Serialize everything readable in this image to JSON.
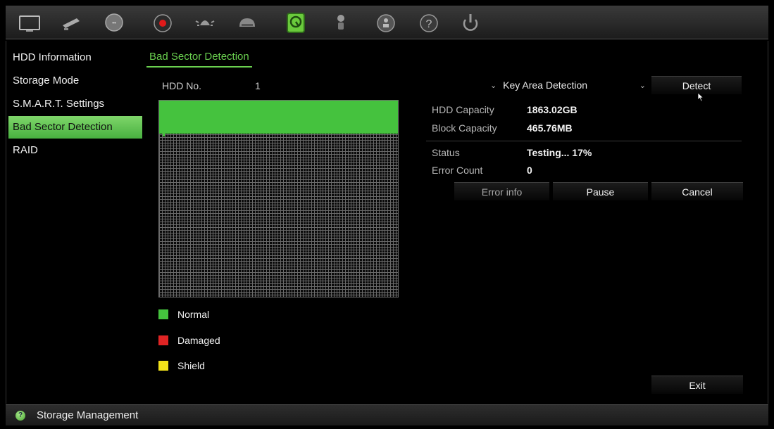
{
  "toolbar": {
    "icons": [
      "display-icon",
      "camera-icon",
      "network-icon",
      "record-icon",
      "alarm-icon",
      "device-icon",
      "hdd-icon",
      "user-icon",
      "system-info-icon",
      "help-icon",
      "power-icon"
    ],
    "active": "hdd-icon"
  },
  "sidebar": {
    "items": [
      {
        "label": "HDD Information"
      },
      {
        "label": "Storage Mode"
      },
      {
        "label": "S.M.A.R.T. Settings"
      },
      {
        "label": "Bad Sector Detection",
        "active": true
      },
      {
        "label": "RAID"
      }
    ]
  },
  "tab": {
    "label": "Bad Sector Detection"
  },
  "hdd": {
    "label": "HDD No.",
    "value": "1"
  },
  "detection": {
    "mode": "Key Area Detection",
    "detect_label": "Detect",
    "progress_fraction": 0.17
  },
  "info": {
    "capacity_label": "HDD Capacity",
    "capacity_value": "1863.02GB",
    "block_label": "Block Capacity",
    "block_value": "465.76MB",
    "status_label": "Status",
    "status_value": "Testing... 17%",
    "error_label": "Error Count",
    "error_value": "0"
  },
  "actions": {
    "error_info": "Error info",
    "pause": "Pause",
    "cancel": "Cancel",
    "exit": "Exit"
  },
  "legend": {
    "normal": {
      "label": "Normal",
      "color": "#45c23e"
    },
    "damaged": {
      "label": "Damaged",
      "color": "#e02424"
    },
    "shield": {
      "label": "Shield",
      "color": "#f2e21a"
    }
  },
  "statusbar": {
    "label": "Storage Management"
  }
}
